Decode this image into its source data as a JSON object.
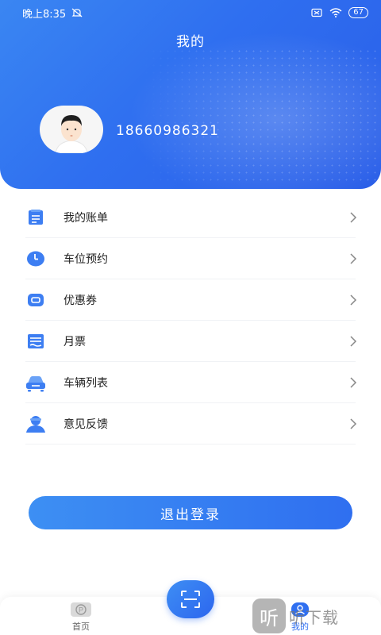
{
  "status_bar": {
    "time": "晚上8:35",
    "battery": "67"
  },
  "header": {
    "title": "我的",
    "phone": "18660986321"
  },
  "menu": [
    {
      "label": "我的账单",
      "icon": "bill-icon"
    },
    {
      "label": "车位预约",
      "icon": "clock-icon"
    },
    {
      "label": "优惠券",
      "icon": "coupon-icon"
    },
    {
      "label": "月票",
      "icon": "monthly-ticket-icon"
    },
    {
      "label": "车辆列表",
      "icon": "car-icon"
    },
    {
      "label": "意见反馈",
      "icon": "feedback-icon"
    }
  ],
  "logout_label": "退出登录",
  "tabbar": {
    "home_label": "首页",
    "mine_label": "我的",
    "home_icon": "parking-icon",
    "scan_icon": "scan-icon",
    "mine_icon": "user-icon"
  },
  "watermark": {
    "badge": "听",
    "text": "听下载"
  },
  "colors": {
    "accent": "#2f6ff0",
    "icon_blue": "#3d7ef2"
  }
}
